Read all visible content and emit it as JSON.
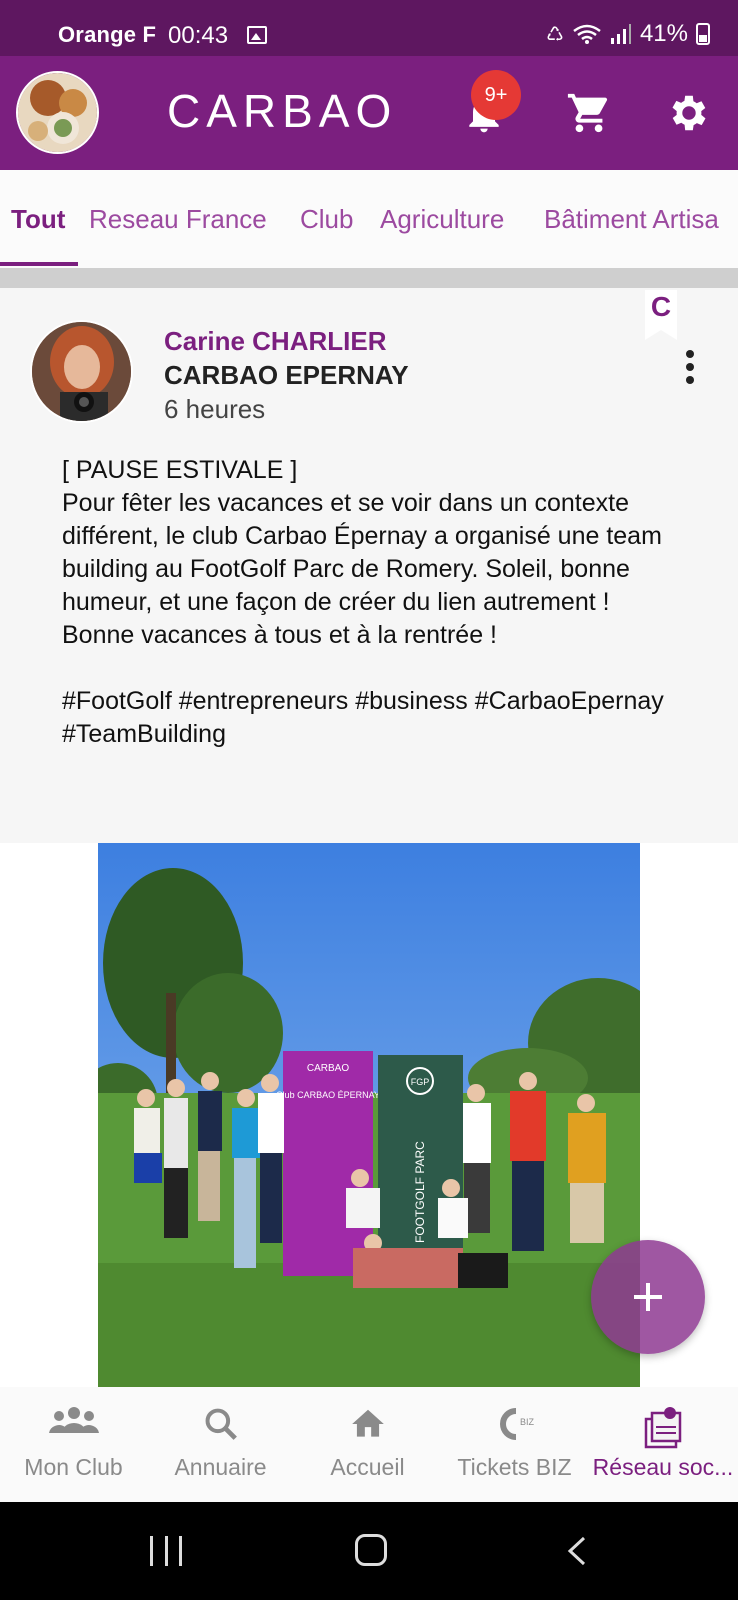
{
  "status_bar": {
    "carrier": "Orange F",
    "time": "00:43",
    "battery": "41%"
  },
  "app_bar": {
    "title": "CARBAO",
    "notification_badge": "9+"
  },
  "tabs": [
    {
      "label": "Tout",
      "active": true
    },
    {
      "label": "Reseau France",
      "active": false
    },
    {
      "label": "Club",
      "active": false
    },
    {
      "label": "Agriculture",
      "active": false
    },
    {
      "label": "Bâtiment Artisa",
      "active": false
    }
  ],
  "post": {
    "corner_badge": "C",
    "author_name": "Carine CHARLIER",
    "club": "CARBAO EPERNAY",
    "time_ago": "6 heures",
    "text": "[ PAUSE ESTIVALE ]\nPour fêter les vacances et se voir dans un contexte différent, le club Carbao Épernay a organisé une team building au FootGolf Parc de Romery. Soleil, bonne humeur, et une façon de créer du lien autrement !\nBonne vacances à tous et à la rentrée !\n\n#FootGolf #entrepreneurs #business #CarbaoEpernay #TeamBuilding",
    "photo": {
      "banner_left_title": "Club CARBAO ÉPERNAY",
      "banner_left_brand": "CARBAO",
      "banner_right_logo": "FGP",
      "banner_right_text": "FOOTGOLF PARC"
    }
  },
  "bottom_nav": [
    {
      "label": "Mon Club",
      "icon": "group-icon",
      "active": false
    },
    {
      "label": "Annuaire",
      "icon": "search-icon",
      "active": false
    },
    {
      "label": "Accueil",
      "icon": "home-icon",
      "active": false
    },
    {
      "label": "Tickets BIZ",
      "icon": "tickets-biz-icon",
      "active": false
    },
    {
      "label": "Réseau soc...",
      "icon": "social-network-icon",
      "active": true
    }
  ],
  "colors": {
    "status_bar": "#5e1760",
    "primary": "#7b1f7f",
    "accent_text": "#9c4aa0",
    "badge": "#e53935",
    "fab": "#8e3a92"
  }
}
